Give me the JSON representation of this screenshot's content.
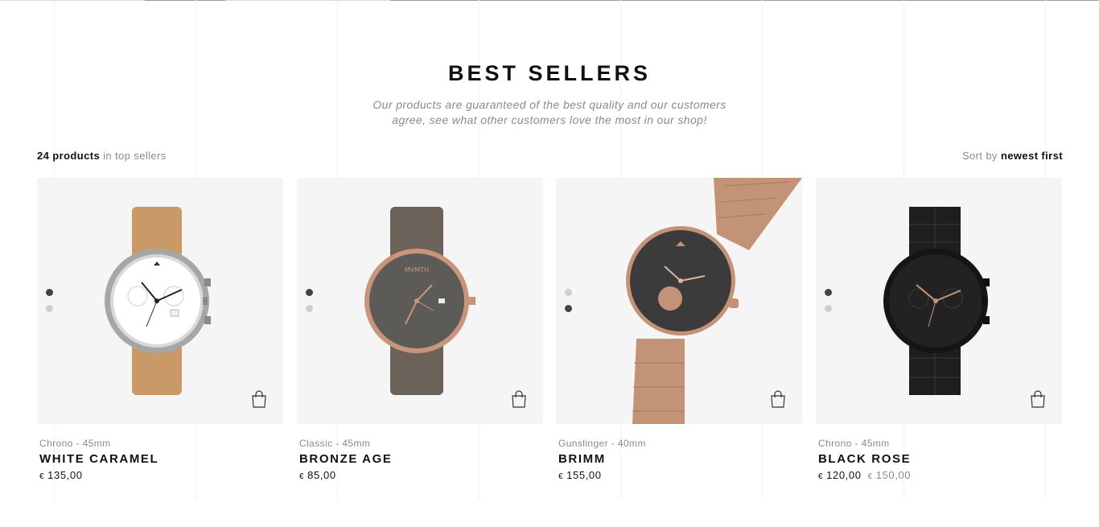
{
  "header": {
    "title": "BEST SELLERS",
    "subtitle_line1": "Our products are guaranteed of the best quality and our customers",
    "subtitle_line2": "agree, see what other customers love the most in our shop!"
  },
  "toolbar": {
    "count_bold": "24 products",
    "count_rest": " in top sellers",
    "sort_label": "Sort by ",
    "sort_value": "newest first"
  },
  "products": [
    {
      "meta": "Chrono - 45mm",
      "name": "WHITE CARAMEL",
      "currency": "€",
      "price": "135,00",
      "old_price": "",
      "icon": "shopping-bag-icon"
    },
    {
      "meta": "Classic - 45mm",
      "name": "BRONZE AGE",
      "currency": "€",
      "price": "85,00",
      "old_price": "",
      "icon": "shopping-bag-icon"
    },
    {
      "meta": "Gunslinger - 40mm",
      "name": "BRIMM",
      "currency": "€",
      "price": "155,00",
      "old_price": "",
      "icon": "shopping-bag-icon"
    },
    {
      "meta": "Chrono - 45mm",
      "name": "BLACK ROSE",
      "currency": "€",
      "price": "120,00",
      "old_currency": "€",
      "old_price": "150,00",
      "icon": "shopping-bag-icon"
    }
  ],
  "colors": {
    "text": "#111111",
    "muted": "#8a8a8a",
    "card_bg": "#f5f5f5",
    "rose_gold": "#c9957a",
    "caramel": "#c99a67"
  }
}
